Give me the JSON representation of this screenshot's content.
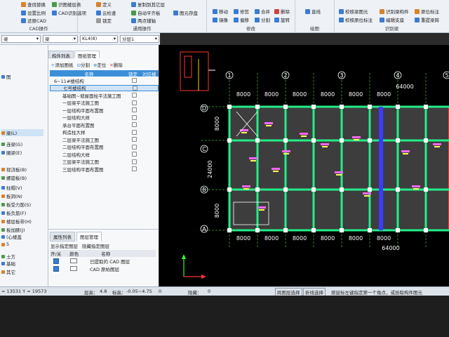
{
  "ribbon": {
    "groups": [
      {
        "label": "CAD操作",
        "buttons": [
          "查找替换",
          "设置比例",
          "还原CAD",
          "识图楼层表",
          "CAD识别选项"
        ]
      },
      {
        "label": "通用操作",
        "buttons": [
          "定义",
          "云检查",
          "锁定",
          "复制到其它层",
          "自动平齐板",
          "两点辅轴",
          "图元存盘"
        ]
      },
      {
        "label": "修改",
        "buttons": [
          "移动",
          "镜像",
          "修剪",
          "偏移",
          "合并",
          "分割",
          "删除",
          "旋转"
        ]
      },
      {
        "label": "绘图",
        "buttons": [
          "直线"
        ]
      },
      {
        "label": "识别梁",
        "buttons": [
          "校核梁图元",
          "校核原位标注",
          "识别梁构件",
          "编辑支座",
          "原位标注",
          "重提梁跨"
        ]
      }
    ]
  },
  "toolbar": {
    "floor_type": "梁",
    "element_type": "梁",
    "element": "KL4(8)",
    "floor": "分层1"
  },
  "left_nav": [
    "图",
    "梁(L)",
    "连梁(G)",
    "圈梁(E)",
    "现浇板(B)",
    "螺旋板(B)",
    "柱帽(V)",
    "板洞(N)",
    "板受力筋(S)",
    "板负筋(F)",
    "楼层板带(H)",
    "板加腋(J)",
    "(心楼盖",
    "5",
    "土方",
    "基础",
    "其它"
  ],
  "panel": {
    "tabs": [
      "构件列表",
      "图纸管理"
    ],
    "tools": [
      "添加图纸",
      "分割",
      "定位",
      "删除"
    ],
    "columns": [
      "名称",
      "锁定",
      "对应楼"
    ],
    "rows": [
      {
        "name": "6~11#楼结构",
        "indent": 0,
        "selected": false
      },
      {
        "name": "七号楼结构",
        "indent": 1,
        "selected": true
      },
      {
        "name": "基础图~坡屋面柱平法施工图",
        "indent": 1,
        "selected": false
      },
      {
        "name": "一层梁平法施工图",
        "indent": 1,
        "selected": false
      },
      {
        "name": "一层结构平面布置图",
        "indent": 1,
        "selected": false
      },
      {
        "name": "一层结构大样",
        "indent": 1,
        "selected": false
      },
      {
        "name": "承台平面布置图",
        "indent": 1,
        "selected": false
      },
      {
        "name": "构造柱大样",
        "indent": 1,
        "selected": false
      },
      {
        "name": "二层梁平法施工图",
        "indent": 1,
        "selected": false
      },
      {
        "name": "二层结构平面布置图",
        "indent": 1,
        "selected": false
      },
      {
        "name": "二层结构大样",
        "indent": 1,
        "selected": false
      },
      {
        "name": "三层梁平法施工图",
        "indent": 1,
        "selected": false
      },
      {
        "name": "三层结构平面布置图",
        "indent": 1,
        "selected": false
      }
    ]
  },
  "lower_panel": {
    "tabs": [
      "属性列表",
      "图层管理"
    ],
    "options": [
      "显示指定图层",
      "隐藏指定图层"
    ],
    "columns": [
      "开/关",
      "颜色",
      "名称"
    ],
    "layers": [
      "已提取的 CAD 图层",
      "CAD 原始图层"
    ]
  },
  "status": {
    "coords": "= 13531 Y = 19573",
    "floor_height": "层高：",
    "floor_height_val": "4.8",
    "elevation": "标高：",
    "elevation_val": "-0.05~4.75",
    "zero": "0",
    "hidden": "隐藏：",
    "hidden_val": "0",
    "cross_select": "跨图层选择",
    "polyline_select": "折线选择",
    "hint": "按鼠标左键指定第一个角点，或拾取构件图元"
  },
  "drawing": {
    "top_labels": [
      "1",
      "2",
      "3",
      "4",
      "5"
    ],
    "left_labels": [
      "D",
      "C",
      "B",
      "A"
    ],
    "top_dims": [
      "8000",
      "8000",
      "8000",
      "8000",
      "8000",
      "8000"
    ],
    "top_total": "64000",
    "left_dims": [
      "8000",
      "24000",
      "8000"
    ],
    "bottom_dims": [
      "8000",
      "8000",
      "8000",
      "8000",
      "8000",
      "8000"
    ],
    "bottom_total": "64000"
  }
}
